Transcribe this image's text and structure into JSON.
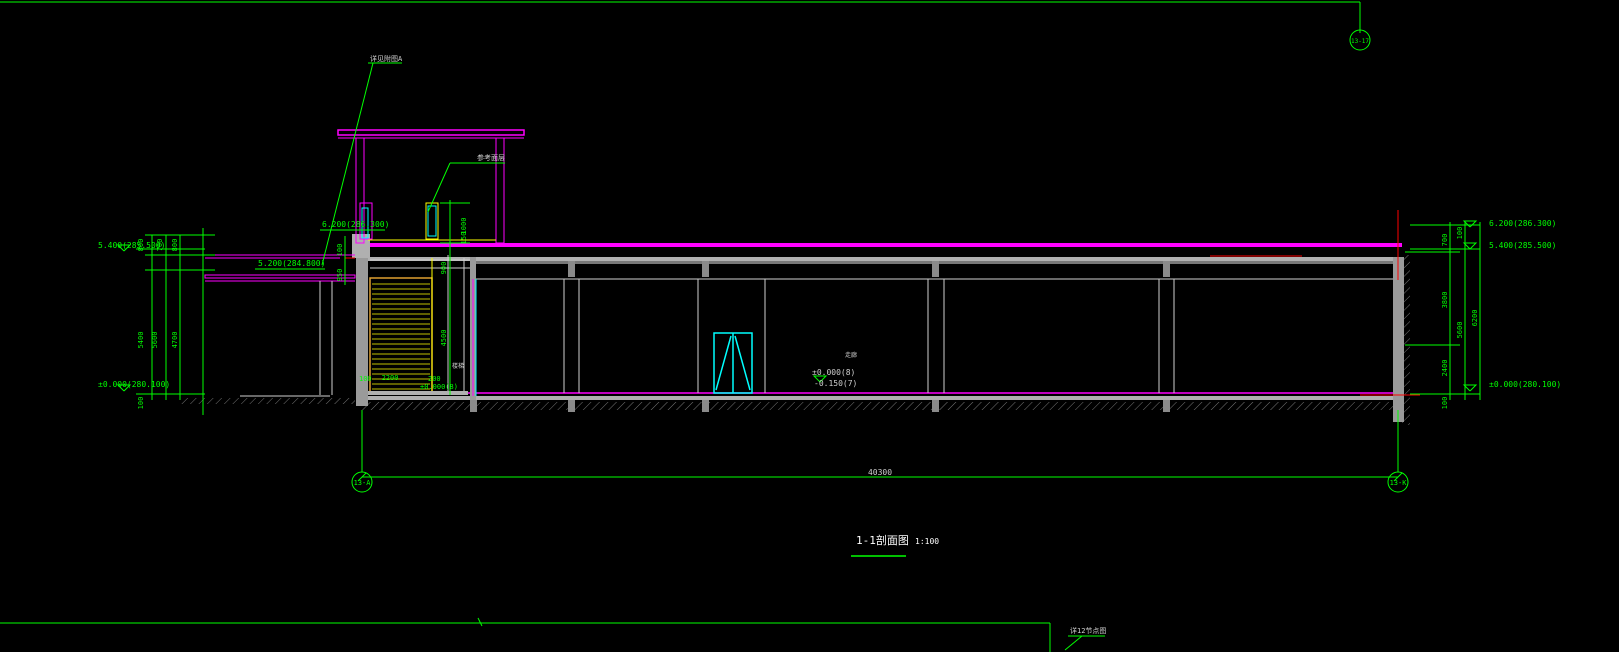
{
  "drawing": {
    "title": "1-1剖面图",
    "scale": "1:100",
    "top_grid_tag": "13-17",
    "bottom_note": "详12节点图",
    "overall_dim": "40300"
  },
  "grids": {
    "left": "13-A",
    "right": "13-K"
  },
  "left_elevations": {
    "roof": "5.400(285.500)",
    "floor": "±0.000(280.100)"
  },
  "right_elevations": {
    "top": "6.200(286.300)",
    "roof": "5.400(285.500)",
    "floor": "±0.000(280.100)"
  },
  "center_levels": {
    "canopy": "6.200(286.300)",
    "eave": "5.200(284.800)",
    "floor_a": "±0.000(8)",
    "floor_b": "-0.150(7)"
  },
  "stair": {
    "run": "2200",
    "rise": "4500",
    "landing": "±0.000(8)",
    "start": "100",
    "step": "200"
  },
  "leaders": {
    "note1": "详见附图A",
    "note2": "参考面层",
    "room_tag": "楼梯",
    "room_tag2": "走廊"
  },
  "left_dims": {
    "d_total": "5400",
    "d_alt": "5600",
    "d_inner": "4700",
    "d_top1": "800",
    "d_top2": "700",
    "d_top3": "800",
    "d_bot": "100"
  },
  "right_dims": {
    "d_total": "6200",
    "d_alt": "5600",
    "d_upper": "3800",
    "d_lower": "2400",
    "d_top1": "700",
    "d_top2": "100",
    "d_bot": "100"
  },
  "center_dims": {
    "parapet": "150",
    "canopy_h": "1000",
    "stair_gap": "950",
    "stair_gap2": "100",
    "upper": "900"
  },
  "colors": {
    "bg": "#000000",
    "green": "#00ff00",
    "magenta": "#ff00ff",
    "white": "#ffffff",
    "grey": "#9a9a9a",
    "cyan": "#00ffff",
    "yellow": "#ffff00",
    "orange": "#e0a030",
    "red": "#ff0000"
  }
}
